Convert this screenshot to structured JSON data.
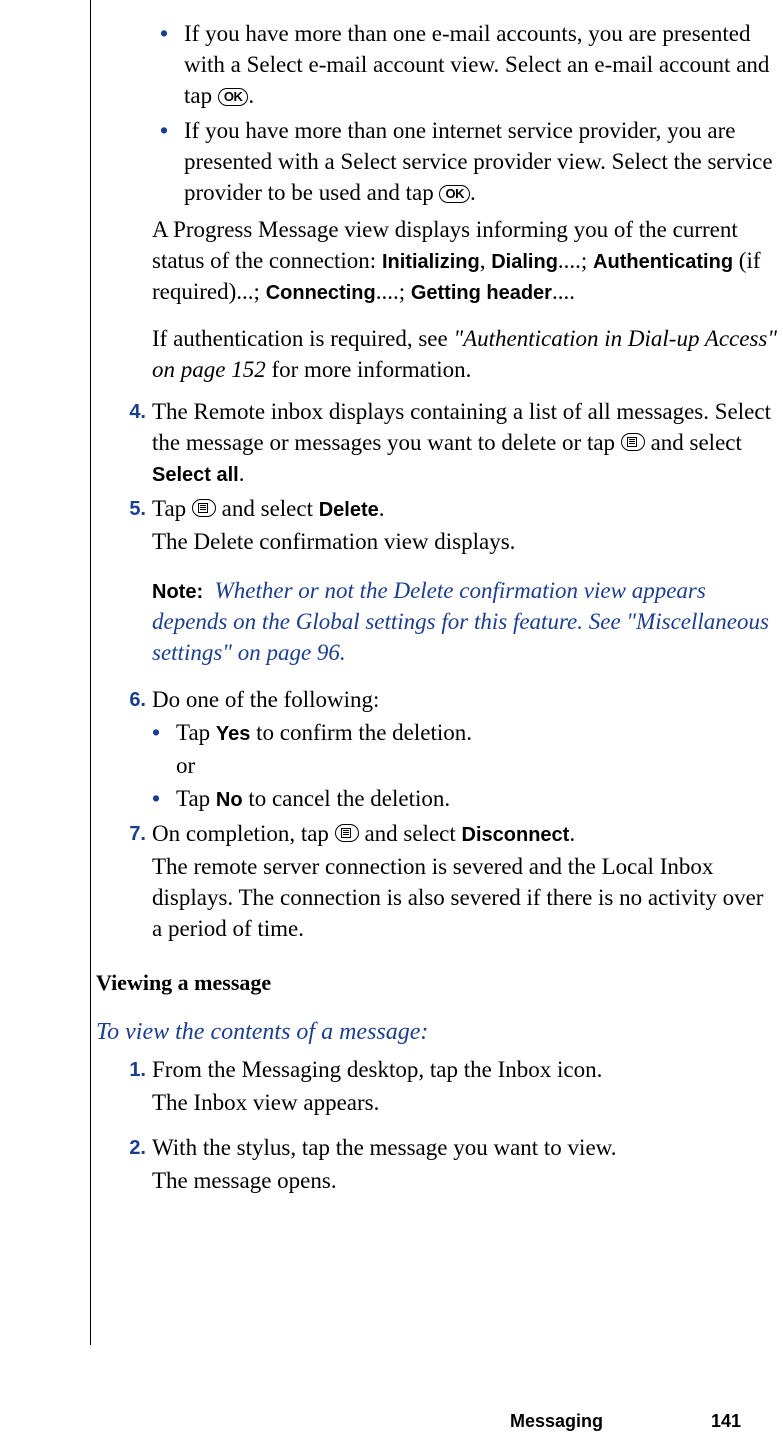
{
  "bullets_top": [
    {
      "pre": "If you have more than one e-mail accounts, you are presented with a Select e-mail account view. Select an e-mail account and tap ",
      "icon": "ok",
      "post": "."
    },
    {
      "pre": "If you have more than one internet service provider, you are presented with a Select service provider view. Select the service provider to be used and tap ",
      "icon": "ok",
      "post": "."
    }
  ],
  "progress_para": {
    "t1": "A Progress Message view displays informing you of the current status of the connection: ",
    "b1": "Initializing",
    "t2": ", ",
    "b2": "Dialing",
    "t3": "....; ",
    "b3": "Authenticating",
    "t4": " (if required)...; ",
    "b4": "Connecting",
    "t5": "....; ",
    "b5": "Getting header",
    "t6": "...."
  },
  "auth_para": {
    "t1": "If authentication is required, see ",
    "i1": "\"Authentication in Dial-up Access\" on page 152",
    "t2": " for more information."
  },
  "step4": {
    "num": "4.",
    "t1": "The Remote inbox displays containing a list of all messages. Select the message or messages you want to delete or tap ",
    "icon1": "menu",
    "t2": " and select ",
    "b1": "Select all",
    "t3": "."
  },
  "step5": {
    "num": "5.",
    "t1": "Tap ",
    "icon1": "menu",
    "t2": " and select ",
    "b1": "Delete",
    "t3": ".",
    "line2": "The Delete confirmation view displays."
  },
  "note": {
    "label": "Note:",
    "text": "Whether or not the Delete confirmation view appears depends on the Global settings for this feature. See \"Miscellaneous settings\" on page 96."
  },
  "step6": {
    "num": "6.",
    "t1": "Do one of the following:",
    "sub": [
      {
        "pre": "Tap ",
        "b": "Yes",
        "post": " to confirm the deletion.",
        "or": "or"
      },
      {
        "pre": "Tap ",
        "b": "No",
        "post": " to cancel the deletion."
      }
    ]
  },
  "step7": {
    "num": "7.",
    "t1": "On completion, tap ",
    "icon1": "menu",
    "t2": " and select ",
    "b1": "Disconnect",
    "t3": ".",
    "line2": "The remote server connection is severed and the Local Inbox displays. The connection is also severed if there is no activity over a period of time."
  },
  "section_heading": "Viewing a message",
  "subsection_heading": "To view the contents of a message:",
  "view_step1": {
    "num": "1.",
    "t1": "From the Messaging desktop, tap the Inbox icon.",
    "line2": "The Inbox view appears."
  },
  "view_step2": {
    "num": "2.",
    "t1": "With the stylus, tap the message you want to view.",
    "line2": "The message opens."
  },
  "footer": {
    "label": "Messaging",
    "page": "141"
  },
  "icons": {
    "ok_text": "OK"
  }
}
